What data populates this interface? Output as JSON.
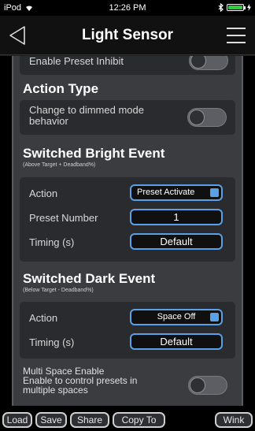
{
  "status_bar": {
    "carrier": "iPod",
    "time": "12:26 PM"
  },
  "nav": {
    "title": "Light Sensor"
  },
  "preset_inhibit": {
    "label": "Enable Preset Inhibit"
  },
  "action_type": {
    "title": "Action Type",
    "label_line1": "Change to dimmed mode",
    "label_line2": "behavior"
  },
  "bright_event": {
    "title": "Switched Bright Event",
    "subtitle": "(Above Target + Deadband%)",
    "action_label": "Action",
    "action_value": "Preset Activate",
    "preset_label": "Preset Number",
    "preset_value": "1",
    "timing_label": "Timing (s)",
    "timing_value": "Default"
  },
  "dark_event": {
    "title": "Switched Dark Event",
    "subtitle": "(Below Target - Deadband%)",
    "action_label": "Action",
    "action_value": "Space Off",
    "timing_label": "Timing (s)",
    "timing_value": "Default"
  },
  "multi_space": {
    "title": "Multi Space Enable",
    "desc_line1": "Enable to control presets in",
    "desc_line2": "multiple spaces"
  },
  "toolbar": {
    "load": "Load",
    "save": "Save",
    "share": "Share",
    "copy_to": "Copy To",
    "wink": "Wink"
  },
  "colors": {
    "accent": "#5aa0e6",
    "battery": "#2ecc40"
  }
}
